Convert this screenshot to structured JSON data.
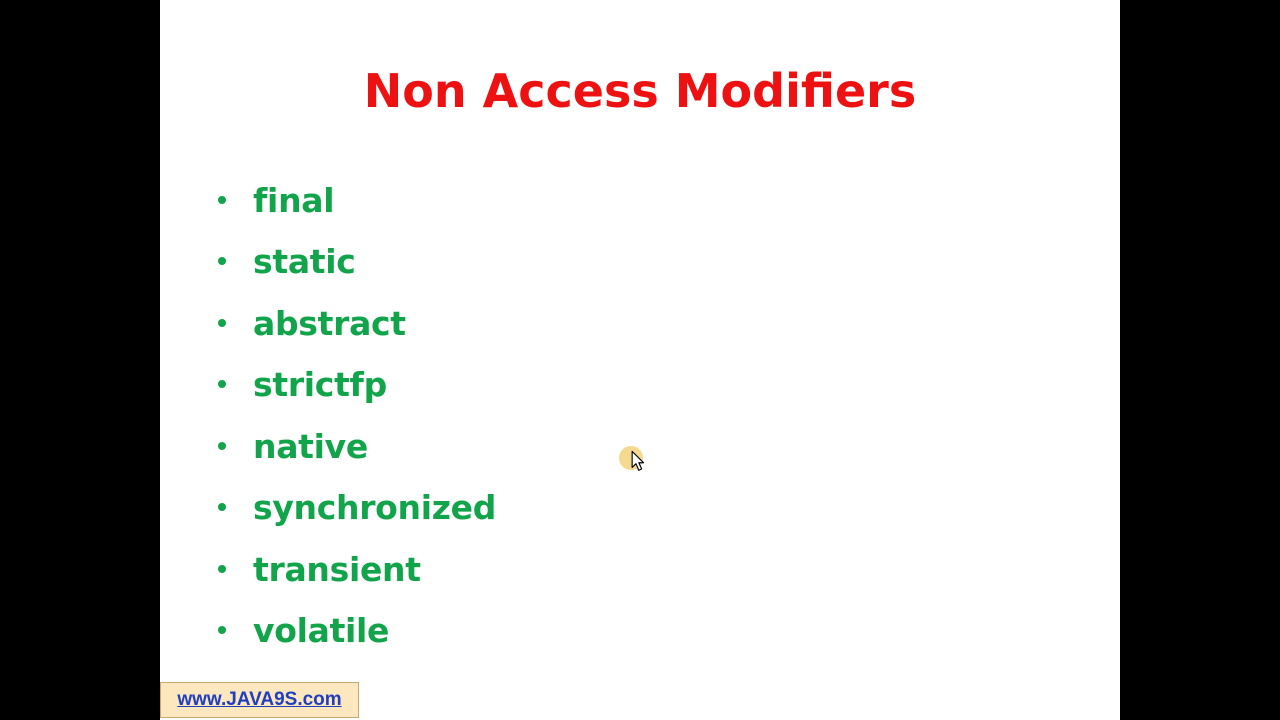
{
  "colors": {
    "title": "#ee1111",
    "bullet_text": "#11a44a",
    "bullet_dot": "#11a44a",
    "watermark_link": "#1f3fbf",
    "watermark_bg": "#fde7bf",
    "cursor_highlight": "#f2d27a"
  },
  "slide": {
    "title": "Non Access Modifiers",
    "bullets": [
      "final",
      "static",
      "abstract",
      "strictfp",
      "native",
      "synchronized",
      "transient",
      "volatile"
    ]
  },
  "watermark": {
    "text": "www.JAVA9S.com"
  },
  "cursor": {
    "icon": "arrow-pointer-icon"
  }
}
